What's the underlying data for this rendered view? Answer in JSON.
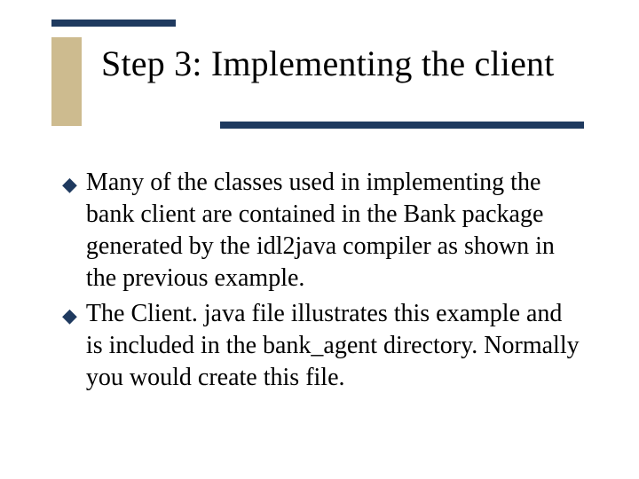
{
  "colors": {
    "bar": "#1f3a5f",
    "accent": "#cdbb8f",
    "bullet": "#1f3a5f"
  },
  "title": "Step 3: Implementing the client",
  "bullets": [
    {
      "text": "Many of the classes used in implementing the bank client are contained in the Bank package generated by the idl2java compiler as shown in the previous example."
    },
    {
      "text": "The Client. java file illustrates this example and is included in the bank_agent directory. Normally you would create this file."
    }
  ]
}
